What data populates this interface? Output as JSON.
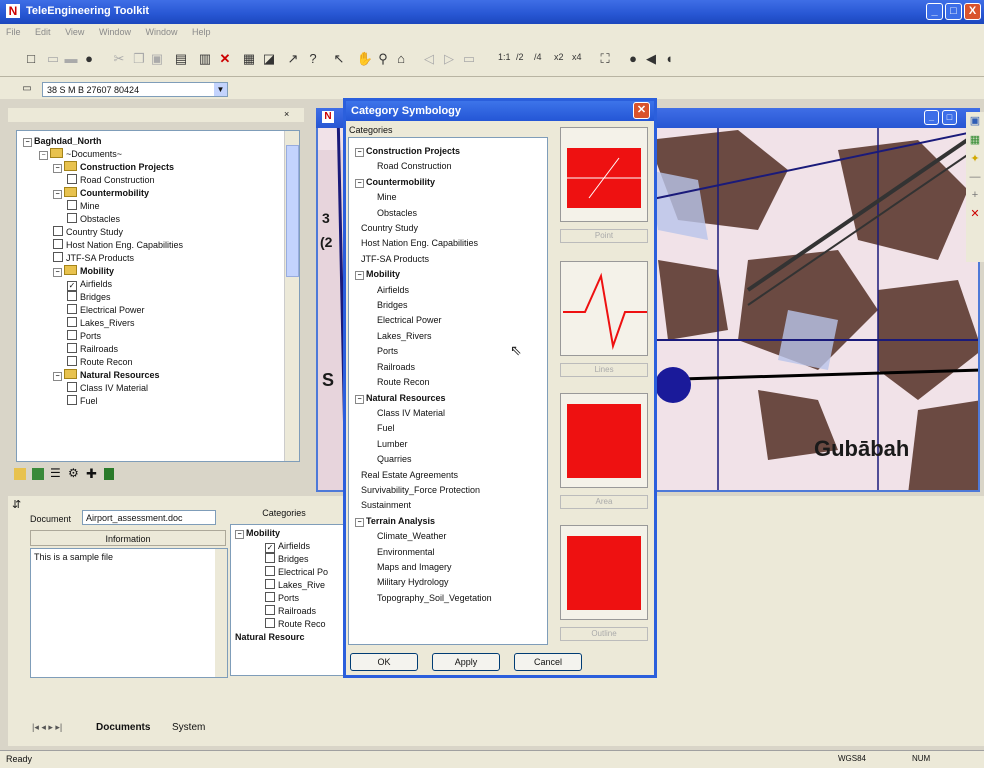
{
  "window": {
    "title": "TeleEngineering Toolkit",
    "minimize": "_",
    "maximize": "□",
    "close": "X"
  },
  "menu": [
    "File",
    "Edit",
    "View",
    "Window",
    "Window",
    "Help"
  ],
  "toolbar": {
    "scale_labels": [
      "1:1",
      "/2",
      "/4",
      "x2",
      "x4"
    ]
  },
  "coord": {
    "value": "38 S M B 27607 80424"
  },
  "tree": {
    "root": "Baghdad_North",
    "documents": "~Documents~",
    "items": [
      {
        "label": "Construction Projects",
        "level": 1,
        "type": "folder",
        "bold": true
      },
      {
        "label": "Road Construction",
        "level": 2,
        "type": "check"
      },
      {
        "label": "Countermobility",
        "level": 1,
        "type": "folder",
        "bold": true
      },
      {
        "label": "Mine",
        "level": 2,
        "type": "check"
      },
      {
        "label": "Obstacles",
        "level": 2,
        "type": "check"
      },
      {
        "label": "Country Study",
        "level": 1,
        "type": "check"
      },
      {
        "label": "Host Nation Eng. Capabilities",
        "level": 1,
        "type": "check"
      },
      {
        "label": "JTF-SA Products",
        "level": 1,
        "type": "check"
      },
      {
        "label": "Mobility",
        "level": 1,
        "type": "folder",
        "bold": true
      },
      {
        "label": "Airfields",
        "level": 2,
        "type": "check",
        "checked": true
      },
      {
        "label": "Bridges",
        "level": 2,
        "type": "check"
      },
      {
        "label": "Electrical Power",
        "level": 2,
        "type": "check"
      },
      {
        "label": "Lakes_Rivers",
        "level": 2,
        "type": "check"
      },
      {
        "label": "Ports",
        "level": 2,
        "type": "check"
      },
      {
        "label": "Railroads",
        "level": 2,
        "type": "check"
      },
      {
        "label": "Route Recon",
        "level": 2,
        "type": "check"
      },
      {
        "label": "Natural Resources",
        "level": 1,
        "type": "folder",
        "bold": true
      },
      {
        "label": "Class IV Material",
        "level": 2,
        "type": "check"
      },
      {
        "label": "Fuel",
        "level": 2,
        "type": "check"
      }
    ]
  },
  "dialog": {
    "title": "Category Symbology",
    "categories_label": "Categories",
    "list": [
      {
        "label": "Construction Projects",
        "bold": true,
        "level": 0
      },
      {
        "label": "Road Construction",
        "level": 1
      },
      {
        "label": "Countermobility",
        "bold": true,
        "level": 0
      },
      {
        "label": "Mine",
        "level": 1
      },
      {
        "label": "Obstacles",
        "level": 1
      },
      {
        "label": "Country Study",
        "level": 0,
        "plain": true
      },
      {
        "label": "Host Nation Eng. Capabilities",
        "level": 0,
        "plain": true
      },
      {
        "label": "JTF-SA Products",
        "level": 0,
        "plain": true
      },
      {
        "label": "Mobility",
        "bold": true,
        "level": 0
      },
      {
        "label": "Airfields",
        "level": 1
      },
      {
        "label": "Bridges",
        "level": 1
      },
      {
        "label": "Electrical Power",
        "level": 1
      },
      {
        "label": "Lakes_Rivers",
        "level": 1
      },
      {
        "label": "Ports",
        "level": 1
      },
      {
        "label": "Railroads",
        "level": 1
      },
      {
        "label": "Route Recon",
        "level": 1
      },
      {
        "label": "Natural Resources",
        "bold": true,
        "level": 0
      },
      {
        "label": "Class IV Material",
        "level": 1
      },
      {
        "label": "Fuel",
        "level": 1
      },
      {
        "label": "Lumber",
        "level": 1
      },
      {
        "label": "Quarries",
        "level": 1
      },
      {
        "label": "Real Estate Agreements",
        "level": 0,
        "plain": true
      },
      {
        "label": "Survivability_Force Protection",
        "level": 0,
        "plain": true
      },
      {
        "label": "Sustainment",
        "level": 0,
        "plain": true
      },
      {
        "label": "Terrain Analysis",
        "bold": true,
        "level": 0
      },
      {
        "label": "Climate_Weather",
        "level": 1
      },
      {
        "label": "Environmental",
        "level": 1
      },
      {
        "label": "Maps and Imagery",
        "level": 1
      },
      {
        "label": "Military Hydrology",
        "level": 1
      },
      {
        "label": "Topography_Soil_Vegetation",
        "level": 1
      }
    ],
    "sym_buttons": [
      "Point",
      "Lines",
      "Area",
      "Outline"
    ],
    "ok": "OK",
    "apply": "Apply",
    "cancel": "Cancel",
    "colors": {
      "symbol": "#e11111"
    }
  },
  "map": {
    "place_label": "Gubābah",
    "partial_labels": [
      "S",
      "3",
      "(2"
    ]
  },
  "bottom": {
    "document_label": "Document",
    "document_value": "Airport_assessment.doc",
    "info_header": "Information",
    "info_text": "This is a sample file",
    "categories_header": "Categories",
    "cat_parent": "Mobility",
    "cat_items": [
      {
        "label": "Airfields",
        "checked": true
      },
      {
        "label": "Bridges"
      },
      {
        "label": "Electrical Po"
      },
      {
        "label": "Lakes_Rive"
      },
      {
        "label": "Ports"
      },
      {
        "label": "Railroads"
      },
      {
        "label": "Route Reco"
      }
    ],
    "cat_partial": "Natural Resourc",
    "tabs": [
      "Documents",
      "System"
    ]
  },
  "status": {
    "left": "Ready",
    "right1": "WGS84",
    "right2": "NUM"
  }
}
